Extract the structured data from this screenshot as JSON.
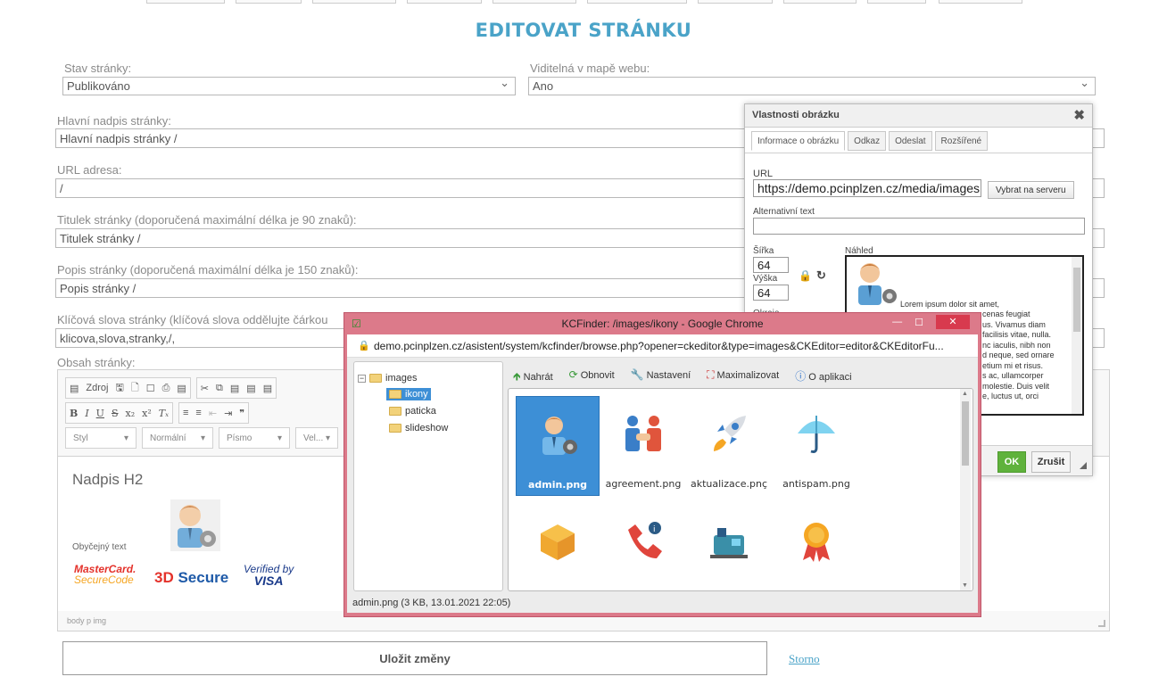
{
  "page": {
    "title": "EDITOVAT STRÁNKU"
  },
  "form": {
    "status_label": "Stav stránky:",
    "status_value": "Publikováno",
    "sitemap_label": "Viditelná v mapě webu:",
    "sitemap_value": "Ano",
    "heading_label": "Hlavní nadpis stránky:",
    "heading_value": "Hlavní nadpis stránky /",
    "url_label": "URL adresa:",
    "url_value": "/",
    "pagetitle_label": "Titulek stránky (doporučená maximální délka je 90 znaků):",
    "pagetitle_value": "Titulek stránky /",
    "desc_label": "Popis stránky (doporučená maximální délka je 150 znaků):",
    "desc_value": "Popis stránky /",
    "keywords_label": "Klíčová slova stránky (klíčová slova oddělujte čárkou",
    "keywords_value": "klicova,slova,stranky,/,",
    "content_label": "Obsah stránky:",
    "save_label": "Uložit změny",
    "cancel_label": "Storno"
  },
  "editor": {
    "source_label": "Zdroj",
    "style_combo": "Styl",
    "format_combo": "Normální",
    "font_combo": "Písmo",
    "size_combo": "Vel...",
    "heading_text": "Nadpis H2",
    "normal_text": "Obyčejný text",
    "mastercard_1": "MasterCard.",
    "mastercard_2": "SecureCode",
    "secure3d_1": "3D",
    "secure3d_2": " Secure",
    "visa_1": "Verified by",
    "visa_2": "VISA",
    "path": "body  p  img"
  },
  "image_dialog": {
    "title": "Vlastnosti obrázku",
    "tabs": [
      "Informace o obrázku",
      "Odkaz",
      "Odeslat",
      "Rozšířené"
    ],
    "url_label": "URL",
    "url_value": "https://demo.pcinplzen.cz/media/images",
    "browse_label": "Vybrat na serveru",
    "alt_label": "Alternativní text",
    "width_label": "Šířka",
    "width_value": "64",
    "height_label": "Výška",
    "height_value": "64",
    "border_label": "Okraje",
    "preview_label": "Náhled",
    "preview_text_1": "Lorem ipsum dolor sit amet,",
    "preview_text_lines": [
      "cenas feugiat",
      "us. Vivamus diam",
      "facilisis vitae, nulla.",
      "nc iaculis, nibh non",
      "d neque, sed ornare",
      "etium mi et risus.",
      "s ac, ullamcorper",
      "molestie. Duis velit",
      "e, luctus ut, orci"
    ],
    "ok_label": "OK",
    "cancel_label": "Zrušit"
  },
  "kcfinder": {
    "window_title": "KCFinder: /images/ikony - Google Chrome",
    "address": "demo.pcinplzen.cz/asistent/system/kcfinder/browse.php?opener=ckeditor&type=images&CKEditor=editor&CKEditorFu...",
    "tree": [
      "images",
      "ikony",
      "paticka",
      "slideshow"
    ],
    "toolbar": [
      "Nahrát",
      "Obnovit",
      "Nastavení",
      "Maximalizovat",
      "O aplikaci"
    ],
    "files": [
      "admin.png",
      "agreement.png",
      "aktualizace.pnç",
      "antispam.png"
    ],
    "status": "admin.png (3 KB, 13.01.2021 22:05)"
  },
  "colors": {
    "accent": "#4aa3c8",
    "chrome_frame": "#dc7a8a",
    "selected_file": "#3d8fd6",
    "ok_green": "#5fb23c"
  }
}
